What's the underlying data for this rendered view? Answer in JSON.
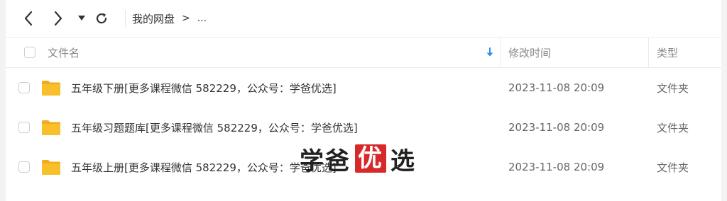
{
  "breadcrumb": {
    "root": "我的网盘",
    "separator": ">",
    "more": "..."
  },
  "columns": {
    "name": "文件名",
    "modified": "修改时间",
    "type": "类型"
  },
  "files": [
    {
      "name": "五年级下册[更多课程微信 582229，公众号：学爸优选]",
      "modified": "2023-11-08 20:09",
      "type": "文件夹"
    },
    {
      "name": "五年级习题题库[更多课程微信 582229，公众号：学爸优选]",
      "modified": "2023-11-08 20:09",
      "type": "文件夹"
    },
    {
      "name": "五年级上册[更多课程微信 582229，公众号：学爸优选]",
      "modified": "2023-11-08 20:09",
      "type": "文件夹"
    }
  ],
  "watermark": {
    "part1": "学爸",
    "badge": "优",
    "part2": "选"
  },
  "colors": {
    "folder": "#f7c02b",
    "folder_back": "#f2ab1d",
    "sort_arrow": "#2f8cf0",
    "watermark_badge": "#d62a2a"
  }
}
